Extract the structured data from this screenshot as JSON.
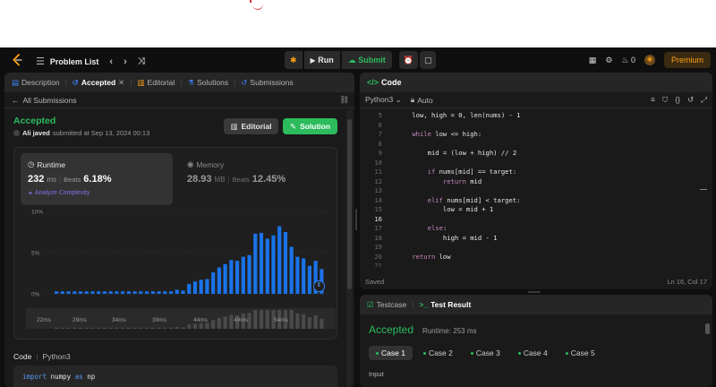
{
  "nav": {
    "problem_list": "Problem List",
    "run": "Run",
    "submit": "Submit",
    "streak": "0",
    "premium": "Premium"
  },
  "left_tabs": [
    {
      "label": "Description"
    },
    {
      "label": "Accepted"
    },
    {
      "label": "Editorial"
    },
    {
      "label": "Solutions"
    },
    {
      "label": "Submissions"
    }
  ],
  "submission": {
    "back_label": "All Submissions",
    "status": "Accepted",
    "author": "Ali javed",
    "submitted_text": "submitted at Sep 13, 2024 00:13",
    "editorial_btn": "Editorial",
    "solution_btn": "Solution"
  },
  "runtime": {
    "label": "Runtime",
    "value": "232",
    "unit": "ms",
    "beats_label": "Beats",
    "beats_value": "6.18%",
    "analyze": "Analyze Complexity"
  },
  "memory": {
    "label": "Memory",
    "value": "28.93",
    "unit": "MB",
    "beats_label": "Beats",
    "beats_value": "12.45%"
  },
  "chart_data": {
    "type": "bar",
    "y_ticks": [
      "10%",
      "5%",
      "0%"
    ],
    "ylim": [
      0,
      10
    ],
    "x_ticks": [
      "22ms",
      "29ms",
      "34ms",
      "39ms",
      "44ms",
      "49ms",
      "54ms"
    ],
    "values": [
      0.3,
      0.3,
      0.3,
      0.3,
      0.3,
      0.3,
      0.3,
      0.3,
      0.3,
      0.3,
      0.3,
      0.3,
      0.3,
      0.3,
      0.3,
      0.3,
      0.3,
      0.3,
      0.3,
      0.3,
      0.5,
      0.4,
      1.2,
      1.5,
      1.7,
      1.8,
      2.6,
      3.2,
      3.6,
      4.1,
      4.0,
      4.5,
      4.7,
      7.3,
      7.4,
      6.7,
      7.1,
      8.2,
      7.5,
      5.7,
      4.5,
      4.3,
      3.4,
      4.0,
      3.0
    ]
  },
  "code_section": {
    "label": "Code",
    "lang": "Python3",
    "first_line_kw1": "import",
    "first_line_mod": " numpy ",
    "first_line_kw2": "as",
    "first_line_alias": " np"
  },
  "editor": {
    "title": "Code",
    "lang": "Python3",
    "mode": "Auto",
    "status_left": "Saved",
    "status_right": "Ln 16, Col 17",
    "lines": [
      {
        "n": "5",
        "pre": "    low, high = 0, len(nums) - 1",
        "kw": "",
        "post": ""
      },
      {
        "n": "6",
        "pre": "",
        "kw": "",
        "post": ""
      },
      {
        "n": "7",
        "pre": "    ",
        "kw": "while",
        "post": " low <= high:"
      },
      {
        "n": "8",
        "pre": "",
        "kw": "",
        "post": ""
      },
      {
        "n": "9",
        "pre": "        mid = (low + high) // 2",
        "kw": "",
        "post": ""
      },
      {
        "n": "10",
        "pre": "",
        "kw": "",
        "post": ""
      },
      {
        "n": "11",
        "pre": "        ",
        "kw": "if",
        "post": " nums[mid] == target:"
      },
      {
        "n": "12",
        "pre": "            ",
        "kw": "return",
        "post": " mid"
      },
      {
        "n": "13",
        "pre": "",
        "kw": "",
        "post": ""
      },
      {
        "n": "14",
        "pre": "        ",
        "kw": "elif",
        "post": " nums[mid] < target:"
      },
      {
        "n": "15",
        "pre": "            low = mid + 1",
        "kw": "",
        "post": ""
      },
      {
        "n": "16",
        "pre": "",
        "kw": "",
        "post": ""
      },
      {
        "n": "17",
        "pre": "        ",
        "kw": "else",
        "post": ":"
      },
      {
        "n": "18",
        "pre": "            high = mid - 1",
        "kw": "",
        "post": ""
      },
      {
        "n": "19",
        "pre": "",
        "kw": "",
        "post": ""
      },
      {
        "n": "20",
        "pre": "    ",
        "kw": "return",
        "post": " low"
      },
      {
        "n": "21",
        "pre": "",
        "kw": "",
        "post": ""
      }
    ]
  },
  "result": {
    "testcase_tab": "Testcase",
    "result_tab": "Test Result",
    "status": "Accepted",
    "runtime": "Runtime: 253 ms",
    "cases": [
      "Case 1",
      "Case 2",
      "Case 3",
      "Case 4",
      "Case 5"
    ],
    "input_label": "Input"
  },
  "colors": {
    "accent_green": "#2cbb5d",
    "blue": "#1a73e8",
    "brand": "#ffa116"
  }
}
